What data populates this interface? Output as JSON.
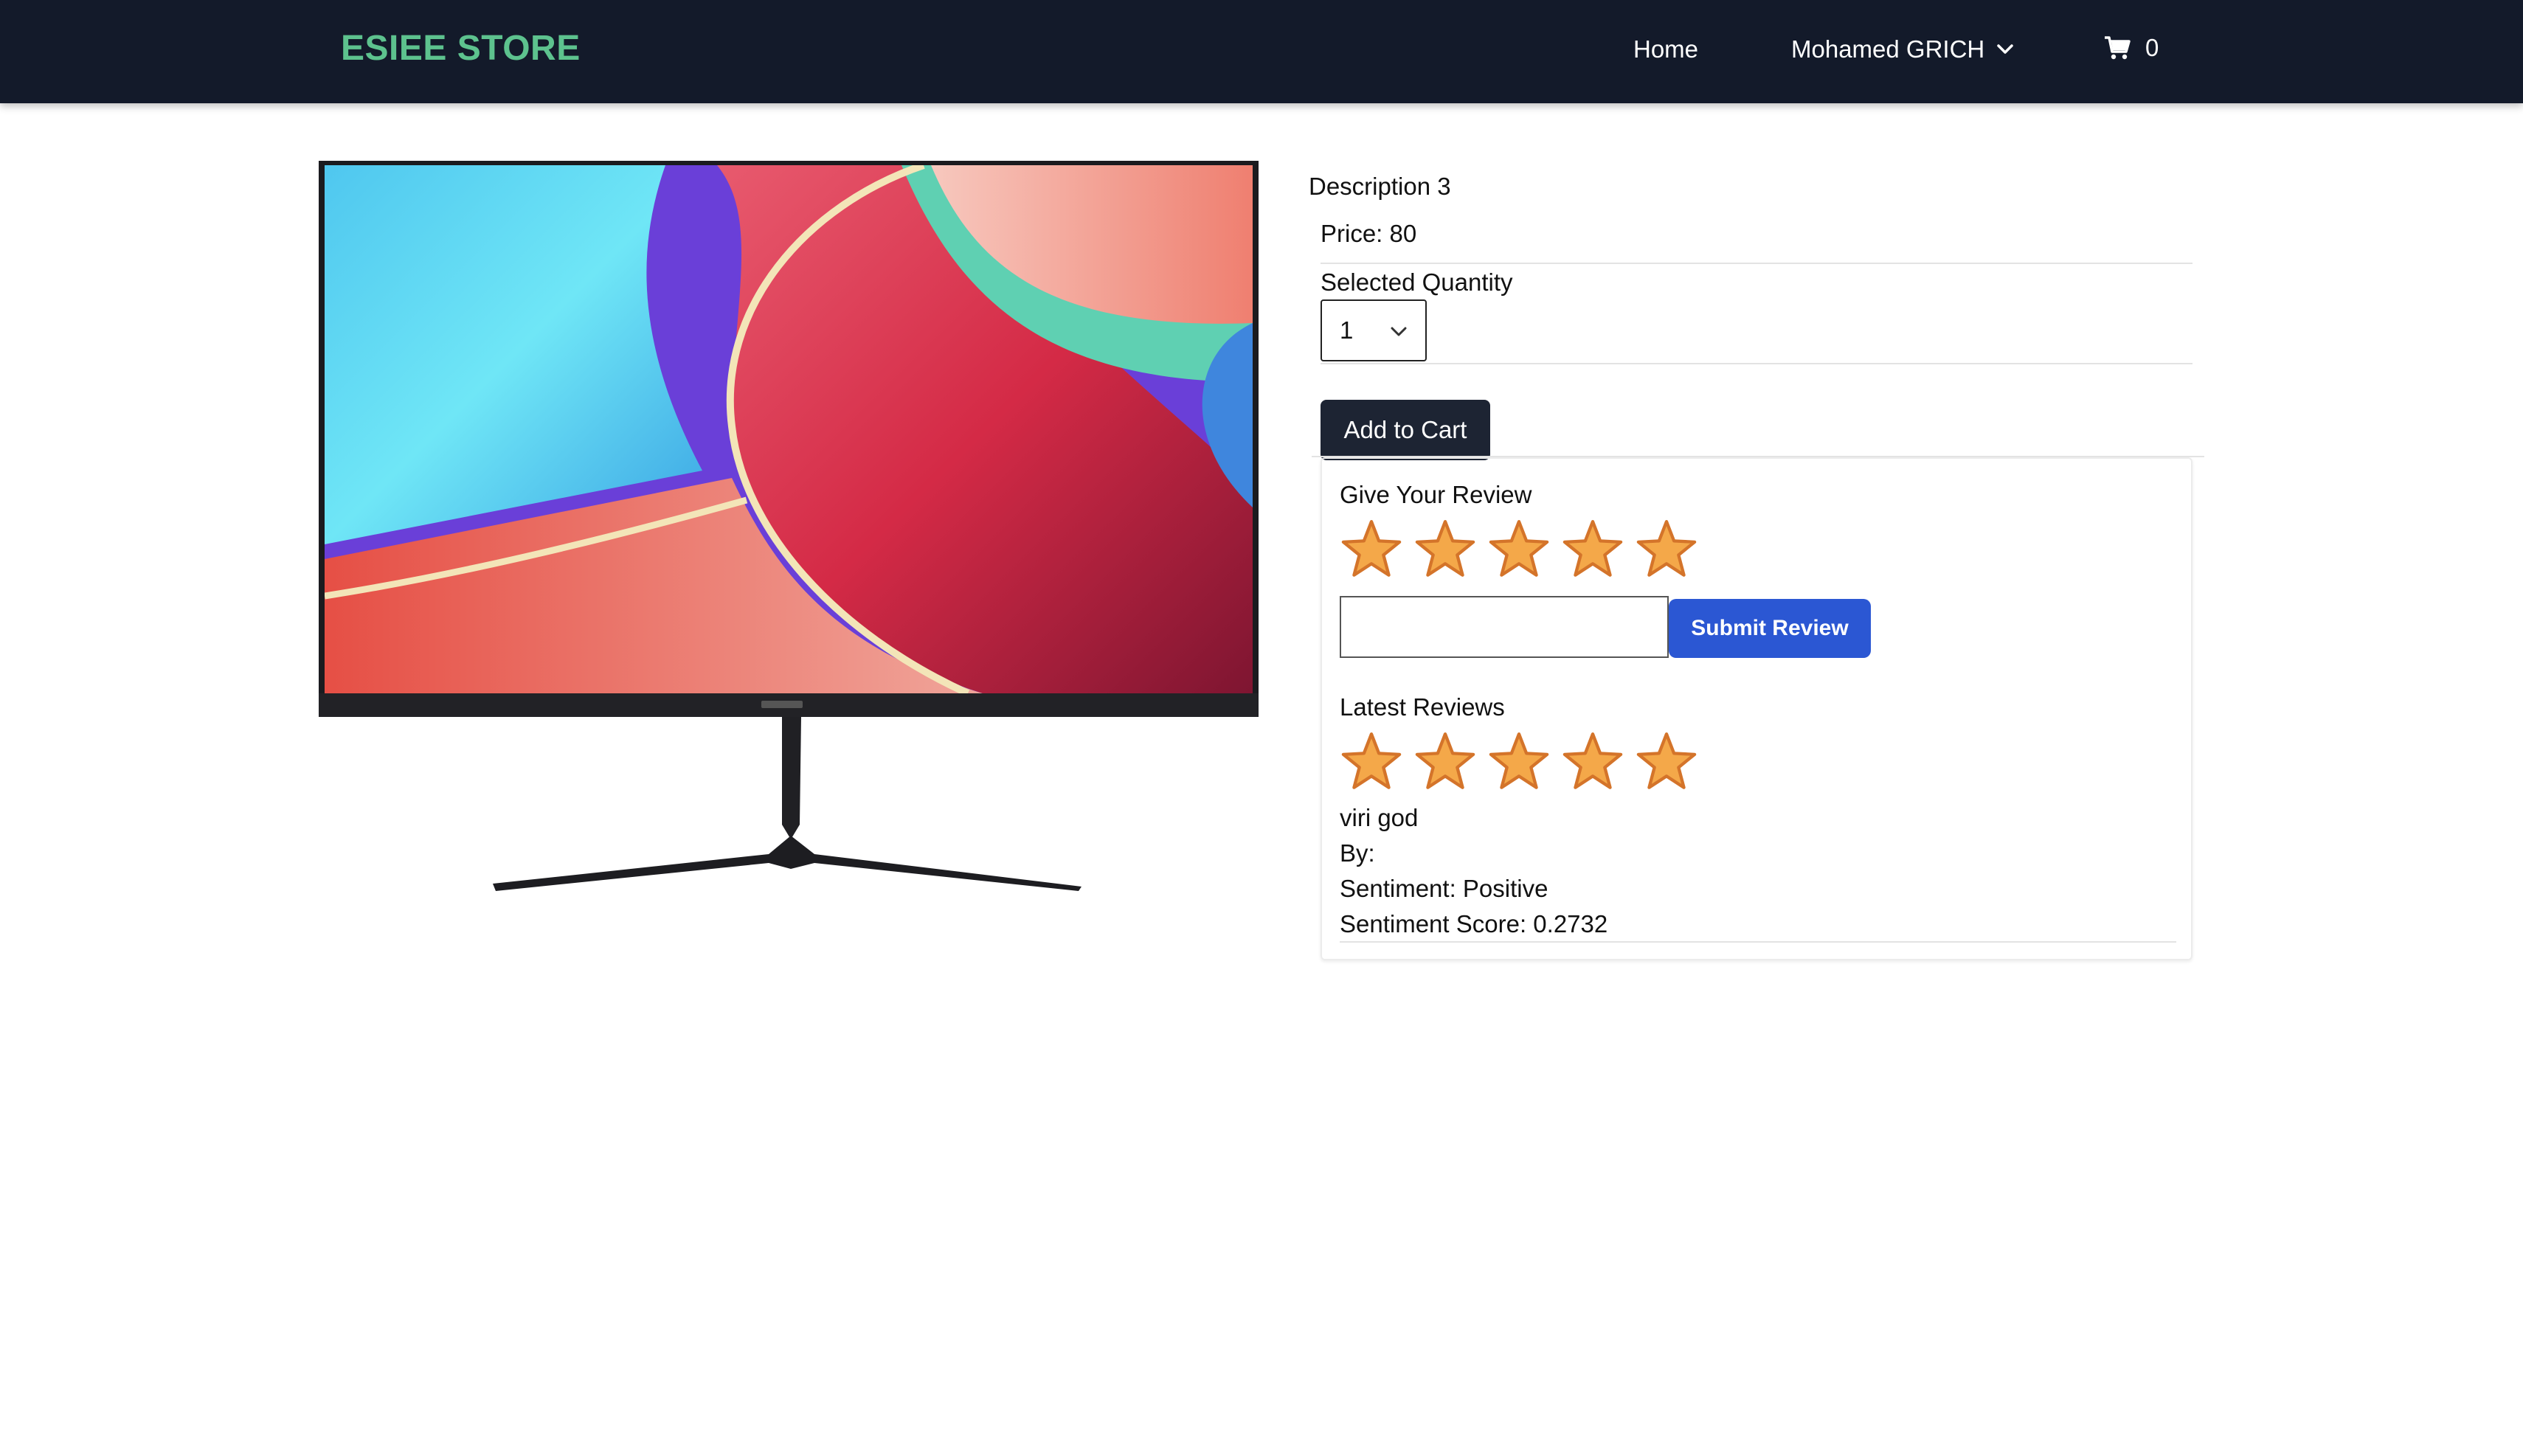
{
  "navbar": {
    "brand": "ESIEE STORE",
    "home_label": "Home",
    "user_label": "Mohamed GRICH",
    "cart_count": "0"
  },
  "product": {
    "description": "Description 3",
    "price_text": "Price: 80",
    "quantity_label": "Selected Quantity",
    "quantity_value": "1",
    "add_to_cart_label": "Add to Cart"
  },
  "review_form": {
    "title": "Give Your Review",
    "rating": 5,
    "max_rating": 5,
    "input_value": "",
    "submit_label": "Submit Review"
  },
  "latest_reviews": {
    "title": "Latest Reviews",
    "items": [
      {
        "rating": 5,
        "comment": "viri god",
        "by_text": "By:",
        "sentiment_text": "Sentiment: Positive",
        "score_text": "Sentiment Score: 0.2732"
      }
    ]
  },
  "colors": {
    "navbar_bg": "#131a2a",
    "brand": "#5dc28e",
    "star_fill": "#f4a849",
    "star_stroke": "#d4742a",
    "submit_bg": "#2b57d3",
    "cart_button_bg": "#1d2433"
  }
}
